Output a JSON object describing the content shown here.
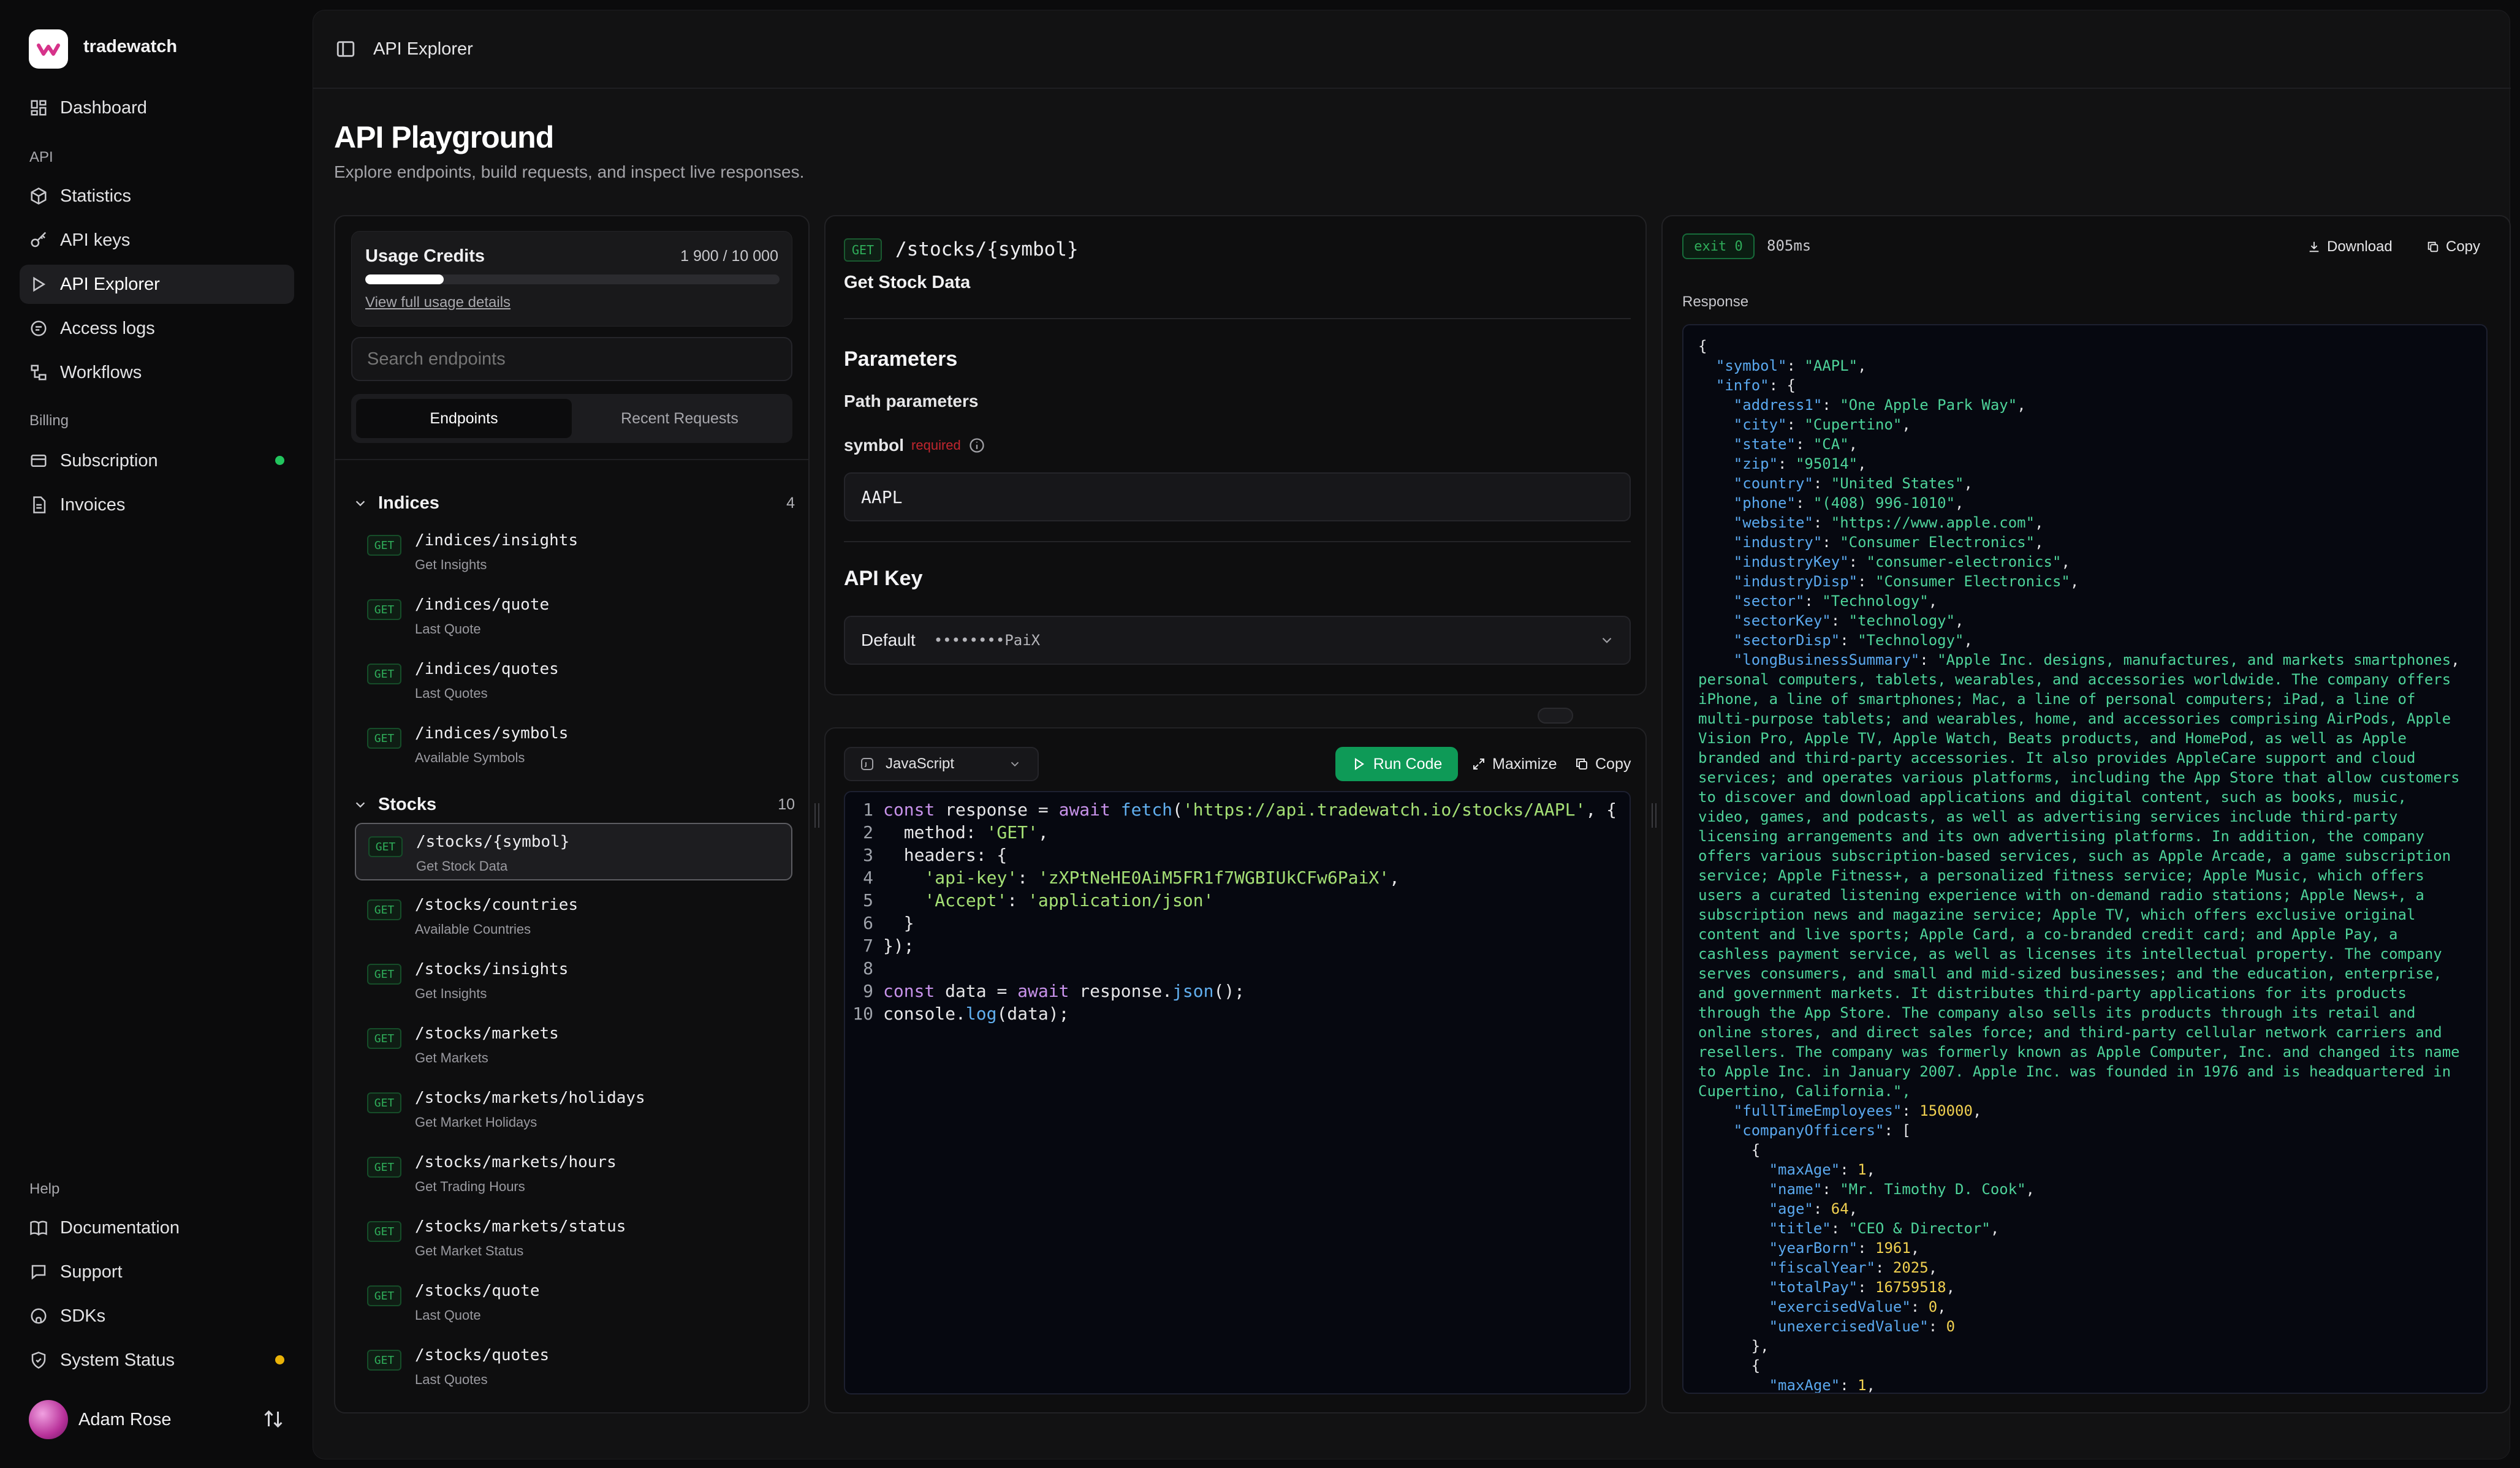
{
  "brand": {
    "name": "tradewatch"
  },
  "sidebar": {
    "dashboard": "Dashboard",
    "api_section": "API",
    "api_items": [
      {
        "label": "Statistics",
        "icon": "package-icon"
      },
      {
        "label": "API keys",
        "icon": "key-icon"
      },
      {
        "label": "API Explorer",
        "icon": "play-icon"
      },
      {
        "label": "Access logs",
        "icon": "list-icon"
      },
      {
        "label": "Workflows",
        "icon": "workflow-icon"
      }
    ],
    "billing_section": "Billing",
    "billing_items": [
      {
        "label": "Subscription",
        "icon": "receipt-icon"
      },
      {
        "label": "Invoices",
        "icon": "invoice-icon"
      }
    ],
    "help_section": "Help",
    "help_items": [
      {
        "label": "Documentation",
        "icon": "book-icon"
      },
      {
        "label": "Support",
        "icon": "chat-icon"
      },
      {
        "label": "SDKs",
        "icon": "github-icon"
      },
      {
        "label": "System Status",
        "icon": "shield-icon"
      }
    ],
    "user": "Adam Rose",
    "colors": {
      "status_green": "#22c55e",
      "status_yellow": "#eab308"
    }
  },
  "topbar": {
    "breadcrumb": "API Explorer"
  },
  "page": {
    "title": "API Playground",
    "subtitle": "Explore endpoints, build requests, and inspect live responses."
  },
  "credits": {
    "title": "Usage Credits",
    "value": "1 900 / 10 000",
    "used_fraction": 0.19,
    "link": "View full usage details"
  },
  "search": {
    "placeholder": "Search endpoints"
  },
  "tabs": {
    "endpoints": "Endpoints",
    "recent": "Recent Requests"
  },
  "groups": [
    {
      "name": "Indices",
      "count": "4",
      "endpoints": [
        {
          "method": "GET",
          "path": "/indices/insights",
          "desc": "Get Insights"
        },
        {
          "method": "GET",
          "path": "/indices/quote",
          "desc": "Last Quote"
        },
        {
          "method": "GET",
          "path": "/indices/quotes",
          "desc": "Last Quotes"
        },
        {
          "method": "GET",
          "path": "/indices/symbols",
          "desc": "Available Symbols"
        }
      ]
    },
    {
      "name": "Stocks",
      "count": "10",
      "endpoints": [
        {
          "method": "GET",
          "path": "/stocks/{symbol}",
          "desc": "Get Stock Data"
        },
        {
          "method": "GET",
          "path": "/stocks/countries",
          "desc": "Available Countries"
        },
        {
          "method": "GET",
          "path": "/stocks/insights",
          "desc": "Get Insights"
        },
        {
          "method": "GET",
          "path": "/stocks/markets",
          "desc": "Get Markets"
        },
        {
          "method": "GET",
          "path": "/stocks/markets/holidays",
          "desc": "Get Market Holidays"
        },
        {
          "method": "GET",
          "path": "/stocks/markets/hours",
          "desc": "Get Trading Hours"
        },
        {
          "method": "GET",
          "path": "/stocks/markets/status",
          "desc": "Get Market Status"
        },
        {
          "method": "GET",
          "path": "/stocks/quote",
          "desc": "Last Quote"
        },
        {
          "method": "GET",
          "path": "/stocks/quotes",
          "desc": "Last Quotes"
        }
      ]
    }
  ],
  "request": {
    "method": "GET",
    "path": "/stocks/{symbol}",
    "title": "Get Stock Data",
    "params_heading": "Parameters",
    "path_params": "Path parameters",
    "param_name": "symbol",
    "param_required": "required",
    "param_value": "AAPL",
    "apikey_heading": "API Key",
    "apikey_name": "Default",
    "apikey_masked": "••••••••PaiX"
  },
  "editor": {
    "language": "JavaScript",
    "run": "Run Code",
    "maximize": "Maximize",
    "copy": "Copy",
    "code": [
      "const response = await fetch('https://api.tradewatch.io/stocks/AAPL', {",
      "  method: 'GET',",
      "  headers: {",
      "    'api-key': 'zXPtNeHE0AiM5FR1f7WGBIUkCFw6PaiX',",
      "    'Accept': 'application/json'",
      "  }",
      "});",
      "",
      "const data = await response.json();",
      "console.log(data);"
    ]
  },
  "response": {
    "exit": "exit 0",
    "elapsed": "805ms",
    "download": "Download",
    "copy": "Copy",
    "label": "Response",
    "json": [
      "{",
      "  \"symbol\": \"AAPL\",",
      "  \"info\": {",
      "    \"address1\": \"One Apple Park Way\",",
      "    \"city\": \"Cupertino\",",
      "    \"state\": \"CA\",",
      "    \"zip\": \"95014\",",
      "    \"country\": \"United States\",",
      "    \"phone\": \"(408) 996-1010\",",
      "    \"website\": \"https://www.apple.com\",",
      "    \"industry\": \"Consumer Electronics\",",
      "    \"industryKey\": \"consumer-electronics\",",
      "    \"industryDisp\": \"Consumer Electronics\",",
      "    \"sector\": \"Technology\",",
      "    \"sectorKey\": \"technology\",",
      "    \"sectorDisp\": \"Technology\",",
      "    \"longBusinessSummary\": \"Apple Inc. designs, manufactures, and markets smartphones,",
      "personal computers, tablets, wearables, and accessories worldwide. The company offers",
      "iPhone, a line of smartphones; Mac, a line of personal computers; iPad, a line of",
      "multi-purpose tablets; and wearables, home, and accessories comprising AirPods, Apple",
      "Vision Pro, Apple TV, Apple Watch, Beats products, and HomePod, as well as Apple",
      "branded and third-party accessories. It also provides AppleCare support and cloud",
      "services; and operates various platforms, including the App Store that allow customers",
      "to discover and download applications and digital content, such as books, music,",
      "video, games, and podcasts, as well as advertising services include third-party",
      "licensing arrangements and its own advertising platforms. In addition, the company",
      "offers various subscription-based services, such as Apple Arcade, a game subscription",
      "service; Apple Fitness+, a personalized fitness service; Apple Music, which offers",
      "users a curated listening experience with on-demand radio stations; Apple News+, a",
      "subscription news and magazine service; Apple TV, which offers exclusive original",
      "content and live sports; Apple Card, a co-branded credit card; and Apple Pay, a",
      "cashless payment service, as well as licenses its intellectual property. The company",
      "serves consumers, and small and mid-sized businesses; and the education, enterprise,",
      "and government markets. It distributes third-party applications for its products",
      "through the App Store. The company also sells its products through its retail and",
      "online stores, and direct sales force; and third-party cellular network carriers and",
      "resellers. The company was formerly known as Apple Computer, Inc. and changed its name",
      "to Apple Inc. in January 2007. Apple Inc. was founded in 1976 and is headquartered in",
      "Cupertino, California.\",",
      "    \"fullTimeEmployees\": 150000,",
      "    \"companyOfficers\": [",
      "      {",
      "        \"maxAge\": 1,",
      "        \"name\": \"Mr. Timothy D. Cook\",",
      "        \"age\": 64,",
      "        \"title\": \"CEO & Director\",",
      "        \"yearBorn\": 1961,",
      "        \"fiscalYear\": 2025,",
      "        \"totalPay\": 16759518,",
      "        \"exercisedValue\": 0,",
      "        \"unexercisedValue\": 0",
      "      },",
      "      {",
      "        \"maxAge\": 1,"
    ]
  }
}
